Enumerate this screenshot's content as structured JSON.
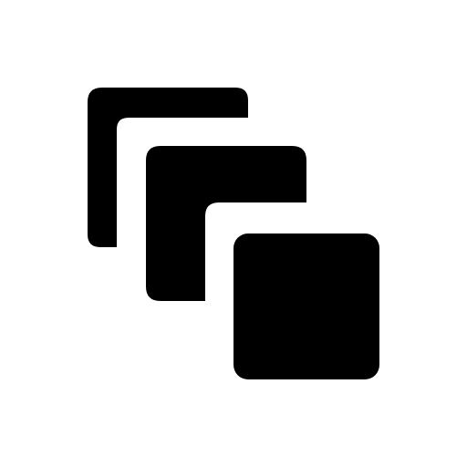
{
  "icon": {
    "name": "stacked-squares-icon",
    "color": "#000000",
    "background": "#ffffff"
  }
}
